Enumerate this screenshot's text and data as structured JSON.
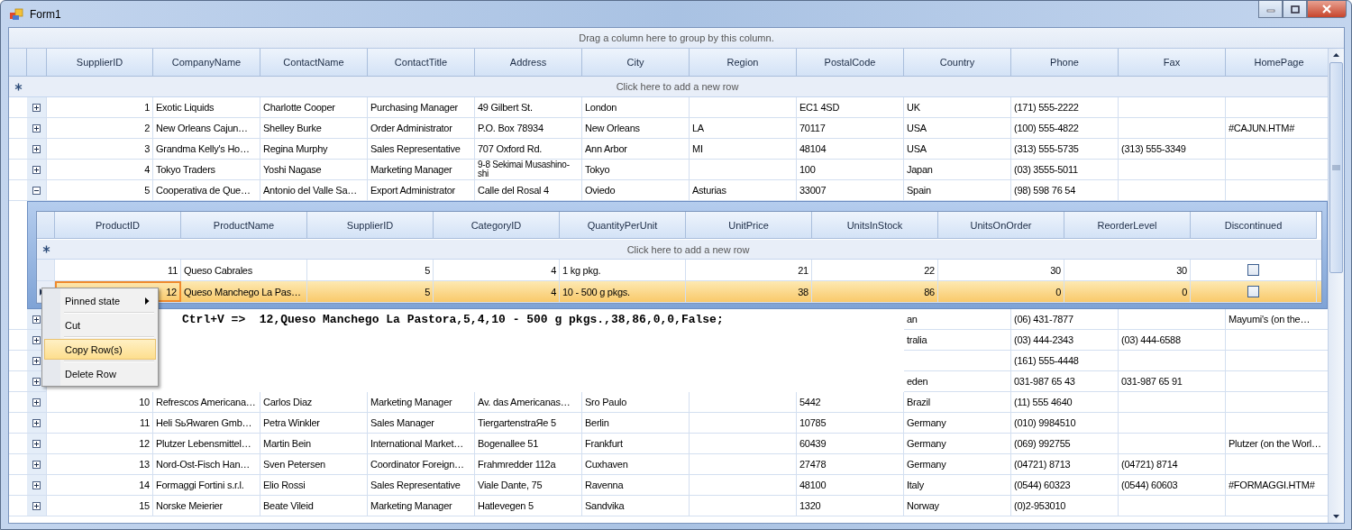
{
  "window": {
    "title": "Form1"
  },
  "group_panel": {
    "text": "Drag a column here to group by this column."
  },
  "grid": {
    "columns": [
      {
        "name": "SupplierID",
        "numeric": true
      },
      {
        "name": "CompanyName",
        "numeric": false
      },
      {
        "name": "ContactName",
        "numeric": false
      },
      {
        "name": "ContactTitle",
        "numeric": false
      },
      {
        "name": "Address",
        "numeric": false
      },
      {
        "name": "City",
        "numeric": false
      },
      {
        "name": "Region",
        "numeric": false
      },
      {
        "name": "PostalCode",
        "numeric": false
      },
      {
        "name": "Country",
        "numeric": false
      },
      {
        "name": "Phone",
        "numeric": false
      },
      {
        "name": "Fax",
        "numeric": false
      },
      {
        "name": "HomePage",
        "numeric": false
      }
    ],
    "new_row_text": "Click here to add a new row",
    "rows": [
      {
        "expanded": false,
        "cells": [
          "1",
          "Exotic Liquids",
          "Charlotte Cooper",
          "Purchasing Manager",
          "49 Gilbert St.",
          "London",
          null,
          "EC1 4SD",
          "UK",
          "(171) 555-2222",
          null,
          null
        ]
      },
      {
        "expanded": false,
        "cells": [
          "2",
          "New Orleans Cajun…",
          "Shelley Burke",
          "Order Administrator",
          "P.O. Box 78934",
          "New Orleans",
          "LA",
          "70117",
          "USA",
          "(100) 555-4822",
          null,
          "#CAJUN.HTM#"
        ]
      },
      {
        "expanded": false,
        "cells": [
          "3",
          "Grandma Kelly's Ho…",
          "Regina Murphy",
          "Sales Representative",
          "707 Oxford Rd.",
          "Ann Arbor",
          "MI",
          "48104",
          "USA",
          "(313) 555-5735",
          "(313) 555-3349",
          null
        ]
      },
      {
        "expanded": false,
        "cells": [
          "4",
          "Tokyo Traders",
          "Yoshi Nagase",
          "Marketing Manager",
          "9-8 Sekimai Musashino-shi",
          "Tokyo",
          null,
          "100",
          "Japan",
          "(03) 3555-5011",
          null,
          null
        ]
      },
      {
        "expanded": true,
        "cells": [
          "5",
          "Cooperativa de Que…",
          "Antonio del Valle Sa…",
          "Export Administrator",
          "Calle del Rosal 4",
          "Oviedo",
          "Asturias",
          "33007",
          "Spain",
          "(98) 598 76 54",
          null,
          null
        ],
        "detail": {
          "columns": [
            {
              "name": "ProductID",
              "numeric": true
            },
            {
              "name": "ProductName",
              "numeric": false
            },
            {
              "name": "SupplierID",
              "numeric": true
            },
            {
              "name": "CategoryID",
              "numeric": true
            },
            {
              "name": "QuantityPerUnit",
              "numeric": false
            },
            {
              "name": "UnitPrice",
              "numeric": true
            },
            {
              "name": "UnitsInStock",
              "numeric": true
            },
            {
              "name": "UnitsOnOrder",
              "numeric": true
            },
            {
              "name": "ReorderLevel",
              "numeric": true
            },
            {
              "name": "Discontinued"
            }
          ],
          "new_row_text": "Click here to add a new row",
          "rows": [
            {
              "selected": false,
              "cells": [
                {
                  "text": "11",
                  "current": false
                },
                {
                  "text": "Queso Cabrales",
                  "current": false
                },
                {
                  "text": "5",
                  "current": false
                },
                {
                  "text": "4",
                  "current": false
                },
                {
                  "text": "1 kg pkg.",
                  "current": false
                },
                {
                  "text": "21",
                  "current": false
                },
                {
                  "text": "22",
                  "current": false
                },
                {
                  "text": "30",
                  "current": false
                },
                {
                  "text": "30",
                  "current": false
                },
                {
                  "kind": "checkbox",
                  "checked": false,
                  "current": false
                }
              ]
            },
            {
              "selected": true,
              "cells": [
                {
                  "text": "12",
                  "current": true
                },
                {
                  "text": "Queso Manchego La Pas…",
                  "current": false
                },
                {
                  "text": "5",
                  "current": false
                },
                {
                  "text": "4",
                  "current": false
                },
                {
                  "text": "10 - 500 g pkgs.",
                  "current": false
                },
                {
                  "text": "38",
                  "current": false
                },
                {
                  "text": "86",
                  "current": false
                },
                {
                  "text": "0",
                  "current": false
                },
                {
                  "text": "0",
                  "current": false
                },
                {
                  "kind": "checkbox",
                  "checked": false,
                  "current": false
                }
              ]
            }
          ]
        }
      },
      {
        "expanded": false,
        "cells": [
          null,
          null,
          null,
          null,
          null,
          null,
          null,
          null,
          "an",
          "(06) 431-7877",
          null,
          "Mayumi's (on the…"
        ]
      },
      {
        "expanded": false,
        "cells": [
          null,
          null,
          null,
          null,
          null,
          null,
          null,
          null,
          "tralia",
          "(03) 444-2343",
          "(03) 444-6588",
          null
        ]
      },
      {
        "expanded": false,
        "cells": [
          null,
          null,
          null,
          null,
          null,
          null,
          null,
          null,
          null,
          "(161) 555-4448",
          null,
          null
        ]
      },
      {
        "expanded": false,
        "cells": [
          null,
          null,
          null,
          null,
          null,
          null,
          null,
          null,
          "eden",
          "031-987 65 43",
          "031-987 65 91",
          null
        ]
      },
      {
        "expanded": false,
        "cells": [
          "10",
          "Refrescos Americana…",
          "Carlos Diaz",
          "Marketing Manager",
          "Av. das Americanas…",
          "Sro Paulo",
          null,
          "5442",
          "Brazil",
          "(11) 555 4640",
          null,
          null
        ]
      },
      {
        "expanded": false,
        "cells": [
          "11",
          "Heli SьЯwaren Gmb…",
          "Petra Winkler",
          "Sales Manager",
          "TiergartenstraЯe 5",
          "Berlin",
          null,
          "10785",
          "Germany",
          "(010) 9984510",
          null,
          null
        ]
      },
      {
        "expanded": false,
        "cells": [
          "12",
          "Plutzer Lebensmittel…",
          "Martin Bein",
          "International Market…",
          "Bogenallee 51",
          "Frankfurt",
          null,
          "60439",
          "Germany",
          "(069) 992755",
          null,
          "Plutzer (on the Worl…"
        ]
      },
      {
        "expanded": false,
        "cells": [
          "13",
          "Nord-Ost-Fisch Han…",
          "Sven Petersen",
          "Coordinator Foreign…",
          "Frahmredder 112a",
          "Cuxhaven",
          null,
          "27478",
          "Germany",
          "(04721) 8713",
          "(04721) 8714",
          null
        ]
      },
      {
        "expanded": false,
        "cells": [
          "14",
          "Formaggi Fortini s.r.l.",
          "Elio Rossi",
          "Sales Representative",
          "Viale Dante, 75",
          "Ravenna",
          null,
          "48100",
          "Italy",
          "(0544) 60323",
          "(0544) 60603",
          "#FORMAGGI.HTM#"
        ]
      },
      {
        "expanded": false,
        "cells": [
          "15",
          "Norske Meierier",
          "Beate Vileid",
          "Marketing Manager",
          "Hatlevegen 5",
          "Sandvika",
          null,
          "1320",
          "Norway",
          "(0)2-953010",
          null,
          null
        ]
      }
    ]
  },
  "clipboard_note": {
    "text": "Ctrl+V =>  12,Queso Manchego La Pastora,5,4,10 - 500 g pkgs.,38,86,0,0,False;"
  },
  "context_menu": {
    "items": [
      {
        "label": "Pinned state",
        "kind": "submenu",
        "selected": false
      },
      {
        "label": "Cut",
        "kind": "item",
        "selected": false
      },
      {
        "label": "Copy Row(s)",
        "kind": "item",
        "selected": true
      },
      {
        "label": "Delete Row",
        "kind": "item",
        "selected": false
      }
    ]
  }
}
